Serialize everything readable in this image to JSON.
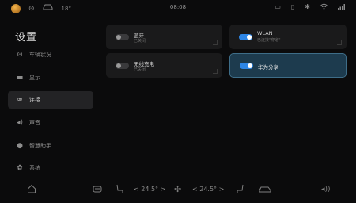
{
  "status_bar": {
    "temperature": "18°",
    "time": "08:08",
    "left_icons": [
      "avatar-icon",
      "steering-icon",
      "car-icon"
    ],
    "right_icons": [
      "camera-icon",
      "vibrate-icon",
      "bluetooth-icon",
      "wifi-icon",
      "signal-icon"
    ]
  },
  "page_title": "设置",
  "sidebar": {
    "items": [
      {
        "label": "车辆状况",
        "icon": "car-status-icon",
        "active": false
      },
      {
        "label": "显示",
        "icon": "display-icon",
        "active": false
      },
      {
        "label": "连接",
        "icon": "link-icon",
        "active": true
      },
      {
        "label": "声音",
        "icon": "speaker-icon",
        "active": false
      },
      {
        "label": "智慧助手",
        "icon": "assistant-icon",
        "active": false
      },
      {
        "label": "系统",
        "icon": "system-gear-icon",
        "active": false
      }
    ]
  },
  "cards": {
    "bluetooth": {
      "title": "蓝牙",
      "status": "已关闭",
      "enabled": false
    },
    "wlan": {
      "title": "WLAN",
      "status": "已连接\"穿道\"",
      "enabled": true
    },
    "wireless_charging": {
      "title": "无线充电",
      "status": "已关闭",
      "enabled": false
    },
    "huawei_share": {
      "title": "华为分享",
      "status": "",
      "enabled": true
    }
  },
  "dock": {
    "left_temp": "< 24.5° >",
    "right_temp": "< 24.5° >",
    "icons": [
      "home-icon",
      "seat-heat-icon",
      "seat-icon",
      "fan-icon",
      "wiper-icon",
      "car-icon",
      "volume-icon"
    ]
  },
  "colors": {
    "background": "#0b0b0c",
    "card": "#1a1a1b",
    "card_active": "#1d3b4e",
    "toggle_on": "#2e86e6",
    "sidebar_active": "#232325"
  }
}
